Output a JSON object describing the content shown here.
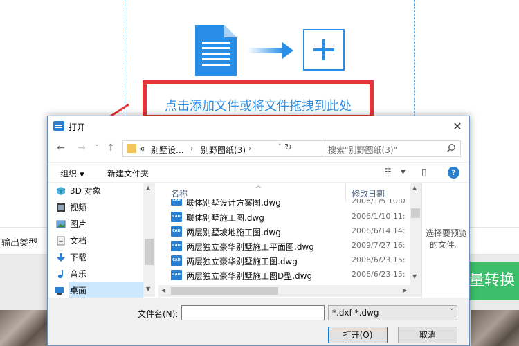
{
  "background": {
    "drop_hint": "点击添加文件或将文件拖拽到此处",
    "output_type_label": "输出类型",
    "convert_button_label": "量转换"
  },
  "dialog": {
    "title": "打开",
    "address": {
      "overflow": "«",
      "segment1": "别墅设...",
      "segment2": "别野图纸(3)"
    },
    "search_placeholder": "搜索\"别野图纸(3)\"",
    "toolbar": {
      "organize": "组织",
      "new_folder": "新建文件夹"
    },
    "nav_items": [
      {
        "label": "3D 对象",
        "icon": "cube-icon"
      },
      {
        "label": "视频",
        "icon": "video-icon"
      },
      {
        "label": "图片",
        "icon": "picture-icon"
      },
      {
        "label": "文档",
        "icon": "document-icon"
      },
      {
        "label": "下载",
        "icon": "download-icon"
      },
      {
        "label": "音乐",
        "icon": "music-icon"
      },
      {
        "label": "桌面",
        "icon": "desktop-icon"
      }
    ],
    "columns": {
      "name": "名称",
      "date": "修改日期"
    },
    "files": [
      {
        "name": "联体别墅设计方案图.dwg",
        "date": "2006/1/5 10:0"
      },
      {
        "name": "联体别墅施工图.dwg",
        "date": "2006/1/10 11:"
      },
      {
        "name": "两层别墅坡地施工图.dwg",
        "date": "2006/6/14 14:"
      },
      {
        "name": "两层独立豪华别墅施工平面图.dwg",
        "date": "2009/7/27 16:"
      },
      {
        "name": "两层独立豪华别墅施工图.dwg",
        "date": "2006/6/23 15:"
      },
      {
        "name": "两层独立豪华别墅施工图D型.dwg",
        "date": "2006/6/23 15:"
      }
    ],
    "file_icon_text": "CAD",
    "preview_text": "选择要预览的文件。",
    "filename_label": "文件名(N):",
    "filename_value": "",
    "file_type": "*.dxf *.dwg",
    "open_button": "打开(O)",
    "cancel_button": "取消"
  },
  "colors": {
    "accent": "#2b8ee6",
    "highlight_border": "#e53538",
    "convert_green": "#3bbf6a"
  }
}
